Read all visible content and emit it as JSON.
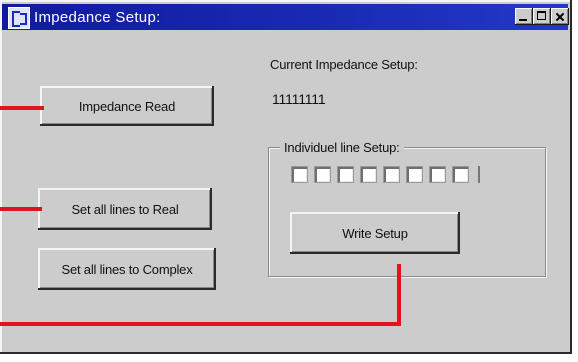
{
  "window": {
    "title": "Impedance Setup:"
  },
  "titlebar_buttons": {
    "minimize": "minimize-icon",
    "maximize": "maximize-icon",
    "close": "close-icon"
  },
  "buttons": {
    "impedance_read": "Impedance Read",
    "set_all_real": "Set all lines to Real",
    "set_all_complex": "Set all lines to Complex",
    "write_setup": "Write Setup"
  },
  "current_setup": {
    "label": "Current Impedance Setup:",
    "value": "11111111"
  },
  "line_setup": {
    "label": "Individuel line Setup:",
    "checkboxes": [
      false,
      false,
      false,
      false,
      false,
      false,
      false,
      false
    ]
  },
  "colors": {
    "titlebar": "#1a2bb4",
    "annotation": "#e0141c",
    "window_bg": "#cccccc"
  }
}
